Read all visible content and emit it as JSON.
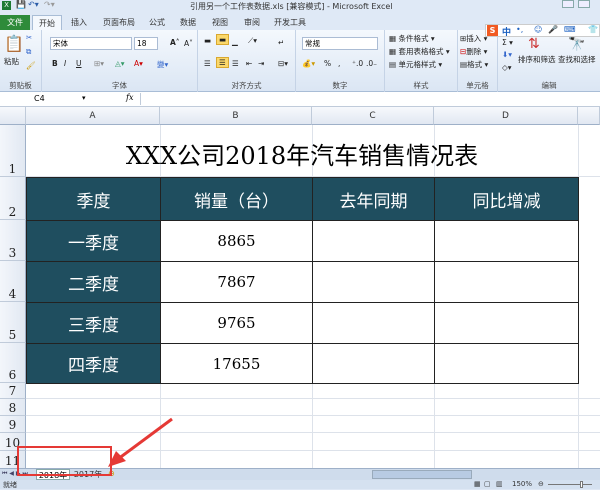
{
  "window": {
    "title": "引用另一个工作表数据.xls  [兼容模式]  -  Microsoft Excel"
  },
  "ribbon_tabs": [
    "文件",
    "开始",
    "插入",
    "页面布局",
    "公式",
    "数据",
    "视图",
    "审阅",
    "开发工具"
  ],
  "ime": {
    "lang": "中",
    "punct": "•,"
  },
  "ribbon": {
    "clipboard": {
      "paste": "粘贴",
      "label": "剪贴板"
    },
    "font": {
      "name": "宋体",
      "size": "18",
      "bold": "B",
      "italic": "I",
      "underline": "U",
      "label": "字体"
    },
    "alignment": {
      "label": "对齐方式"
    },
    "number": {
      "format": "常规",
      "percent": "%",
      "comma": ",",
      "label": "数字"
    },
    "styles": {
      "cond": "条件格式 ▾",
      "table": "套用表格格式 ▾",
      "cell": "单元格样式 ▾",
      "label": "样式"
    },
    "cells": {
      "insert": "插入 ▾",
      "delete": "删除 ▾",
      "format": "格式 ▾",
      "label": "单元格"
    },
    "editing": {
      "sum": "Σ ▾",
      "sort": "排序和筛选",
      "find": "查找和选择",
      "label": "编辑"
    }
  },
  "formula_bar": {
    "name_box": "C4",
    "fx": "fx",
    "value": ""
  },
  "columns": [
    "A",
    "B",
    "C",
    "D"
  ],
  "rows": [
    "1",
    "2",
    "3",
    "4",
    "5",
    "6",
    "7",
    "8",
    "9",
    "10",
    "11"
  ],
  "sheet": {
    "title": "XXX公司2018年汽车销售情况表",
    "headers": [
      "季度",
      "销量（台）",
      "去年同期",
      "同比增减"
    ],
    "data": [
      {
        "q": "一季度",
        "sales": "8865",
        "last": "",
        "change": ""
      },
      {
        "q": "二季度",
        "sales": "7867",
        "last": "",
        "change": ""
      },
      {
        "q": "三季度",
        "sales": "9765",
        "last": "",
        "change": ""
      },
      {
        "q": "四季度",
        "sales": "17655",
        "last": "",
        "change": ""
      }
    ]
  },
  "sheet_tabs": [
    "2018年",
    "2017年"
  ],
  "status": {
    "ready": "就绪",
    "zoom": "150%"
  },
  "colors": {
    "header_fill": "#1f4e5f",
    "annotation": "#e53935"
  }
}
